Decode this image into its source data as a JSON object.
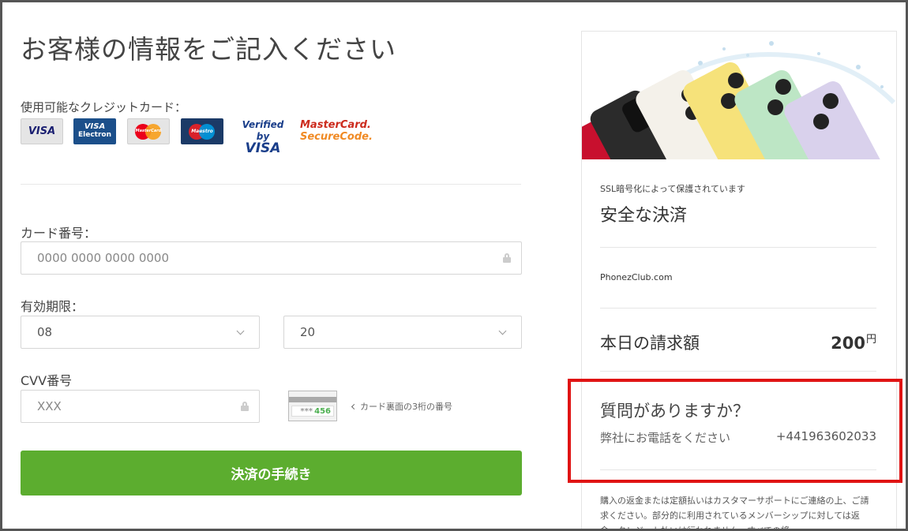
{
  "form": {
    "title": "お客様の情報をご記入ください",
    "accepted_cards_label": "使用可能なクレジットカード：",
    "card_logos": [
      {
        "name": "VISA",
        "line2": ""
      },
      {
        "name": "VISA",
        "line2": "Electron"
      },
      {
        "name": "MasterCard",
        "line2": ""
      },
      {
        "name": "Maestro",
        "line2": ""
      },
      {
        "name": "Verified by",
        "line2": "VISA"
      },
      {
        "name": "MasterCard.",
        "line2": "SecureCode."
      }
    ],
    "card_number_label": "カード番号：",
    "card_number_placeholder": "0000 0000 0000 0000",
    "expiry_label": "有効期限：",
    "expiry_month": "08",
    "expiry_year": "20",
    "cvv_label": "CVV番号",
    "cvv_placeholder": "XXX",
    "cvv_example_stars": "***",
    "cvv_example_digits": "456",
    "cvv_hint": "カード裏面の3桁の番号",
    "submit_label": "決済の手続き"
  },
  "summary": {
    "secure_subtitle": "SSL暗号化によって保護されています",
    "secure_title": "安全な決済",
    "merchant": "PhonezClub.com",
    "today_label": "本日の請求額",
    "amount": "200",
    "currency": "円",
    "question_title": "質問がありますか？",
    "question_sub": "弊社にお電話をください",
    "phone": "+441963602033",
    "refund_text": "購入の返金または定額払いはカスタマーサポートにご連絡の上、ご請求ください。部分的に利用されているメンバーシップに対しては返金、クレジット払いは行われません。すべての将"
  },
  "colors": {
    "submit": "#5cad2f",
    "highlight": "#e01414"
  }
}
